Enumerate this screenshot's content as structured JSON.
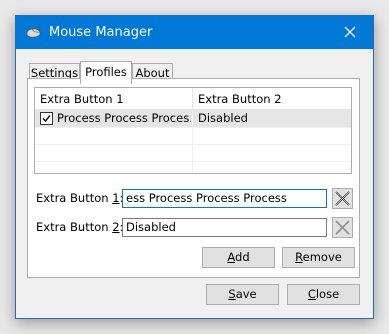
{
  "window": {
    "title": "Mouse Manager",
    "app_icon": "mouse-icon",
    "close_icon": "close-icon"
  },
  "tabs": [
    {
      "label": "Settings",
      "selected": false
    },
    {
      "label": "Profiles",
      "selected": true
    },
    {
      "label": "About",
      "selected": false
    }
  ],
  "profiles_list": {
    "columns": [
      "Extra Button 1",
      "Extra Button 2"
    ],
    "rows": [
      {
        "checked": true,
        "button1": "Process Process Proces…",
        "button2": "Disabled"
      }
    ]
  },
  "fields": {
    "button1": {
      "label_prefix": "Extra Button ",
      "label_key": "1",
      "label_suffix": ":",
      "value": "ess Process Process Process",
      "clear_icon": "clear-x-icon"
    },
    "button2": {
      "label_prefix": "Extra Button ",
      "label_key": "2",
      "label_suffix": ":",
      "value": "Disabled",
      "clear_icon": "clear-x-icon"
    }
  },
  "actions": {
    "add_key": "A",
    "add_rest": "dd",
    "remove_key": "R",
    "remove_rest": "emove"
  },
  "dialog": {
    "save_key": "S",
    "save_rest": "ave",
    "close_key": "C",
    "close_rest": "lose"
  },
  "colors": {
    "titlebar": "#0078d7",
    "selection": "#e5e5e5",
    "focus_border": "#0078d7"
  }
}
